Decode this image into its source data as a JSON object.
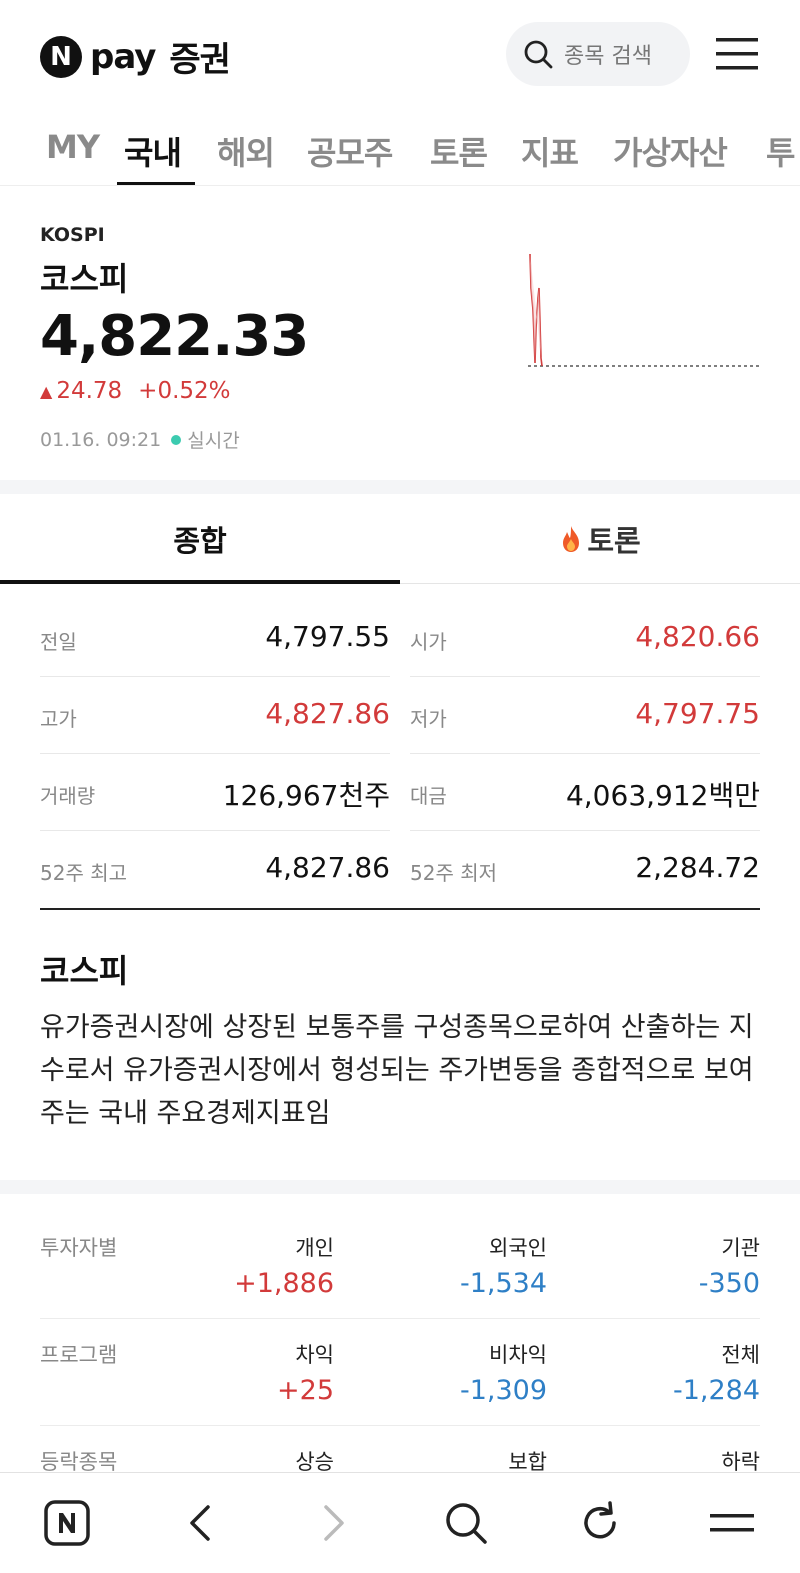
{
  "header": {
    "logo_n": "N",
    "logo_pay": "pay",
    "logo_brand": "증권",
    "search_placeholder": "종목 검색"
  },
  "tabs": [
    "MY",
    "국내",
    "해외",
    "공모주",
    "토론",
    "지표",
    "가상자산",
    "투"
  ],
  "active_tab": "국내",
  "index": {
    "symbol": "KOSPI",
    "name": "코스피",
    "price": "4,822.33",
    "change": "24.78",
    "change_pct": "+0.52%",
    "datetime": "01.16. 09:21",
    "realtime": "실시간"
  },
  "subtabs": {
    "summary": "종합",
    "discussion": "토론"
  },
  "stats": [
    {
      "left_label": "전일",
      "left_value": "4,797.55",
      "right_label": "시가",
      "right_value": "4,820.66"
    },
    {
      "left_label": "고가",
      "left_value": "4,827.86",
      "right_label": "저가",
      "right_value": "4,797.75"
    },
    {
      "left_label": "거래량",
      "left_value": "126,967천주",
      "right_label": "대금",
      "right_value": "4,063,912백만"
    },
    {
      "left_label": "52주 최고",
      "left_value": "4,827.86",
      "right_label": "52주 최저",
      "right_value": "2,284.72"
    }
  ],
  "description": {
    "title": "코스피",
    "text": "유가증권시장에 상장된 보통주를 구성종목으로하여 산출하는 지수로서 유가증권시장에서 형성되는 주가변동을 종합적으로 보여주는 국내 주요경제지표임"
  },
  "investors": [
    {
      "label": "투자자별",
      "cols": [
        {
          "h": "개인",
          "v": "+1,886"
        },
        {
          "h": "외국인",
          "v": "-1,534"
        },
        {
          "h": "기관",
          "v": "-350"
        }
      ]
    },
    {
      "label": "프로그램",
      "cols": [
        {
          "h": "차익",
          "v": "+25"
        },
        {
          "h": "비차익",
          "v": "-1,309"
        },
        {
          "h": "전체",
          "v": "-1,284"
        }
      ]
    },
    {
      "label": "등락종목",
      "cols": [
        {
          "h": "상승",
          "v": ""
        },
        {
          "h": "보합",
          "v": ""
        },
        {
          "h": "하락",
          "v": ""
        }
      ]
    }
  ],
  "colors": {
    "up": "#d23a3a",
    "down": "#2e7fc6",
    "live_dot": "#3ccbb0"
  },
  "bottom_nav": [
    "n-home-icon",
    "back-icon",
    "forward-icon",
    "search-icon",
    "refresh-icon",
    "menu-icon"
  ]
}
